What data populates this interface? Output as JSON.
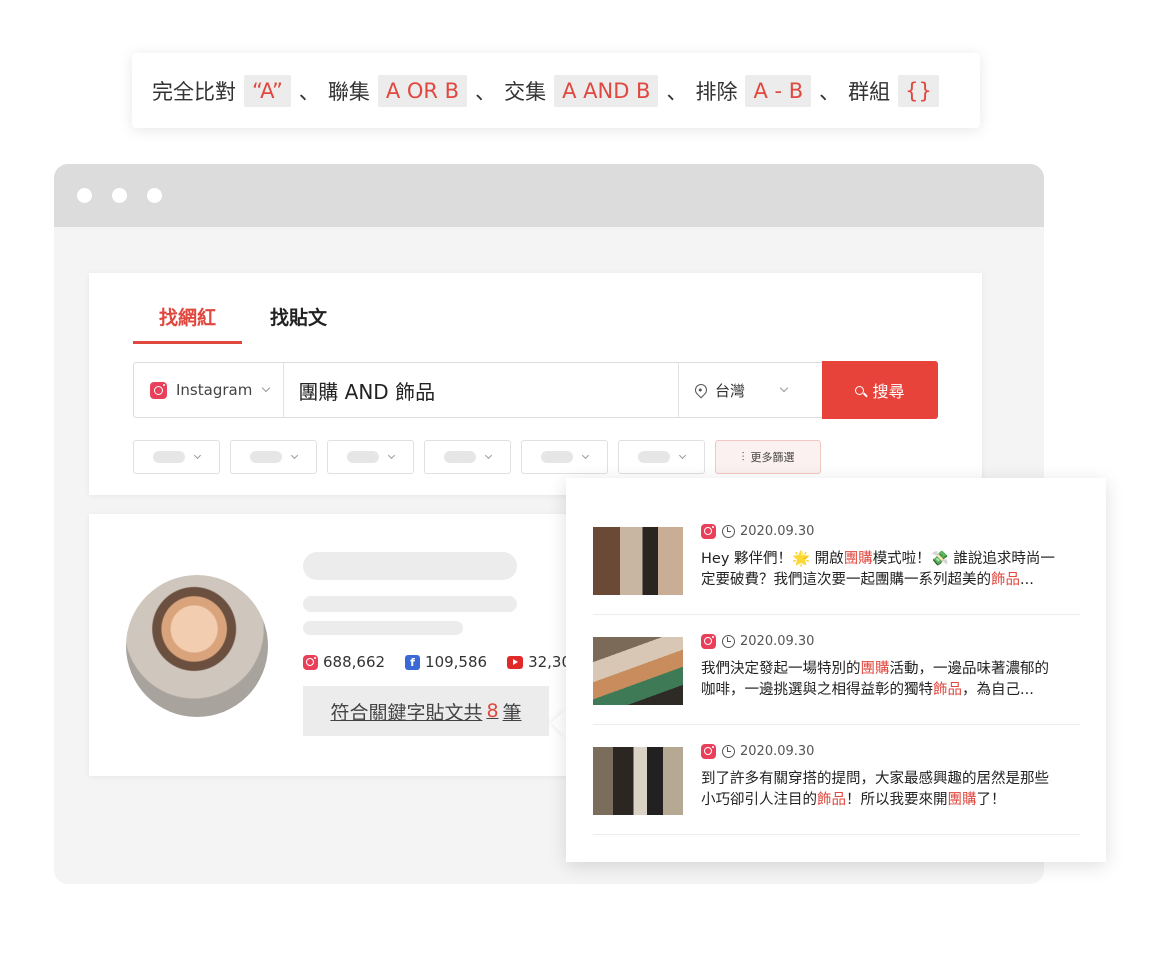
{
  "syntax": {
    "exact_label": "完全比對",
    "exact_code": "“A”",
    "sep": "、",
    "union_label": "聯集",
    "union_code": "A OR B",
    "intersect_label": "交集",
    "intersect_code": "A AND B",
    "exclude_label": "排除",
    "exclude_code": "A - B",
    "group_label": "群組",
    "group_code": "{}"
  },
  "tabs": [
    "找網紅",
    "找貼文"
  ],
  "search": {
    "platform": "Instagram",
    "query": "團購 AND 飾品",
    "location": "台灣",
    "button": "搜尋"
  },
  "more_filters": "更多篩選",
  "sliders_glyph": "⫶",
  "influencer": {
    "stats": {
      "instagram": "688,662",
      "facebook": "109,586",
      "youtube": "32,30"
    },
    "fb_glyph": "f",
    "match_prefix": "符合關鍵字貼文共",
    "match_count": "8",
    "match_suffix": "筆"
  },
  "posts": [
    {
      "date": "2020.09.30",
      "line1_a": "Hey 夥伴們！",
      "line1_e1": "🌟",
      "line1_b": " 開啟",
      "line1_hl": "團購",
      "line1_c": "模式啦！",
      "line1_e2": "💸",
      "line1_d": " 誰說追求時尚一",
      "line2_a": "定要破費？我們這次要一起團購一系列超美的",
      "line2_hl": "飾品",
      "line2_b": "..."
    },
    {
      "date": "2020.09.30",
      "line1_a": "我們決定發起一場特別的",
      "line1_hl": "團購",
      "line1_b": "活動，一邊品味著濃郁的",
      "line2_a": "咖啡，一邊挑選與之相得益彰的獨特",
      "line2_hl": "飾品",
      "line2_b": "，為自己..."
    },
    {
      "date": "2020.09.30",
      "line1": "到了許多有關穿搭的提問，大家最感興趣的居然是那些",
      "line2_a": "小巧卻引人注目的",
      "line2_hl": "飾品",
      "line2_b": "！所以我要來開",
      "line2_hl2": "團購",
      "line2_c": "了！"
    }
  ],
  "colors": {
    "accent": "#e0483f",
    "instagram": "#e8405a",
    "facebook": "#3b69d6",
    "youtube": "#e02a2a"
  }
}
